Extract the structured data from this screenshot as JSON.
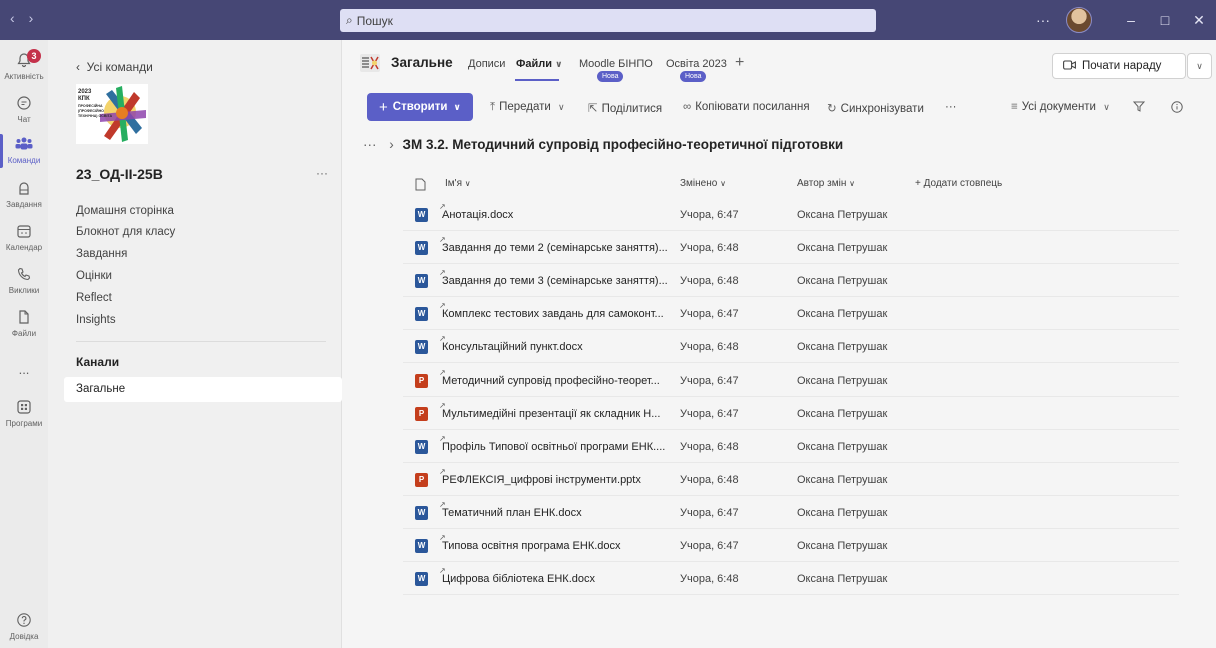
{
  "titlebar": {
    "search_placeholder": "Пошук",
    "more": "···"
  },
  "rail": {
    "items": [
      {
        "label": "Активність",
        "icon": "bell-icon",
        "badge": "3"
      },
      {
        "label": "Чат",
        "icon": "chat-icon"
      },
      {
        "label": "Команди",
        "icon": "teams-icon",
        "active": true
      },
      {
        "label": "Завдання",
        "icon": "assignments-icon"
      },
      {
        "label": "Календар",
        "icon": "calendar-icon"
      },
      {
        "label": "Виклики",
        "icon": "phone-icon"
      },
      {
        "label": "Файли",
        "icon": "file-icon"
      },
      {
        "label": "...",
        "icon": "more-icon"
      },
      {
        "label": "Програми",
        "icon": "apps-icon"
      },
      {
        "label": "Довідка",
        "icon": "help-icon"
      }
    ]
  },
  "leftpanel": {
    "back_label": "Усі команди",
    "team_name": "23_ОД-ІІ-25В",
    "team_more": "···",
    "links": [
      "Домашня сторінка",
      "Блокнот для класу",
      "Завдання",
      "Оцінки",
      "Reflect",
      "Insights"
    ],
    "channels_title": "Канали",
    "active_channel": "Загальне"
  },
  "logo": {
    "line1": "2023",
    "line2": "КПК",
    "line3": "ПРОФЕСІЙНА",
    "line4": "(ПРОФЕСІЙНО",
    "line5": "ТЕХНІЧНА) ОСВІТА"
  },
  "header": {
    "channel_title": "Загальне",
    "tabs": [
      "Дописи",
      "Файли",
      "Moodle БІНПО",
      "Освіта 2023"
    ],
    "new_pill": "Нова",
    "add_tab": "+",
    "meet_button": "Почати нараду"
  },
  "commands": {
    "create": "Створити",
    "upload": "Передати",
    "share": "Поділитися",
    "copy_link": "Копіювати посилання",
    "sync": "Синхронізувати",
    "more": "···",
    "view": "Усі документи"
  },
  "breadcrumb": {
    "dots": "···",
    "current": "ЗМ 3.2. Методичний супровід професійно-теоретичної підготовки"
  },
  "list": {
    "col_name": "Ім'я",
    "col_modified": "Змінено",
    "col_author": "Автор змін",
    "add_column": "+ Додати стовпець",
    "files": [
      {
        "name": "Анотація.docx",
        "modified": "Учора, 6:47",
        "author": "Оксана Петрушак",
        "type": "word"
      },
      {
        "name": "Завдання до теми 2 (семінарське заняття)...",
        "modified": "Учора, 6:48",
        "author": "Оксана Петрушак",
        "type": "word"
      },
      {
        "name": "Завдання до теми 3 (семінарське заняття)...",
        "modified": "Учора, 6:48",
        "author": "Оксана Петрушак",
        "type": "word"
      },
      {
        "name": "Комплекс тестових завдань для самоконт...",
        "modified": "Учора, 6:47",
        "author": "Оксана Петрушак",
        "type": "word"
      },
      {
        "name": "Консультаційний пункт.docx",
        "modified": "Учора, 6:48",
        "author": "Оксана Петрушак",
        "type": "word"
      },
      {
        "name": "Методичний супровід професійно-теорет...",
        "modified": "Учора, 6:47",
        "author": "Оксана Петрушак",
        "type": "ppt"
      },
      {
        "name": "Мультимедійні презентації як складник Н...",
        "modified": "Учора, 6:47",
        "author": "Оксана Петрушак",
        "type": "ppt"
      },
      {
        "name": "Профіль Типової освітньої програми ЕНК....",
        "modified": "Учора, 6:48",
        "author": "Оксана Петрушак",
        "type": "word"
      },
      {
        "name": "РЕФЛЕКСІЯ_цифрові інструменти.pptx",
        "modified": "Учора, 6:48",
        "author": "Оксана Петрушак",
        "type": "ppt"
      },
      {
        "name": "Тематичний план ЕНК.docx",
        "modified": "Учора, 6:47",
        "author": "Оксана Петрушак",
        "type": "word"
      },
      {
        "name": "Типова освітня програма ЕНК.docx",
        "modified": "Учора, 6:47",
        "author": "Оксана Петрушак",
        "type": "word"
      },
      {
        "name": "Цифрова бібліотека ЕНК.docx",
        "modified": "Учора, 6:48",
        "author": "Оксана Петрушак",
        "type": "word"
      }
    ]
  },
  "colors": {
    "titlebar": "#464775",
    "accent": "#5b5fc7",
    "badge": "#c4314b",
    "word": "#2b579a",
    "ppt": "#c43e1c"
  }
}
